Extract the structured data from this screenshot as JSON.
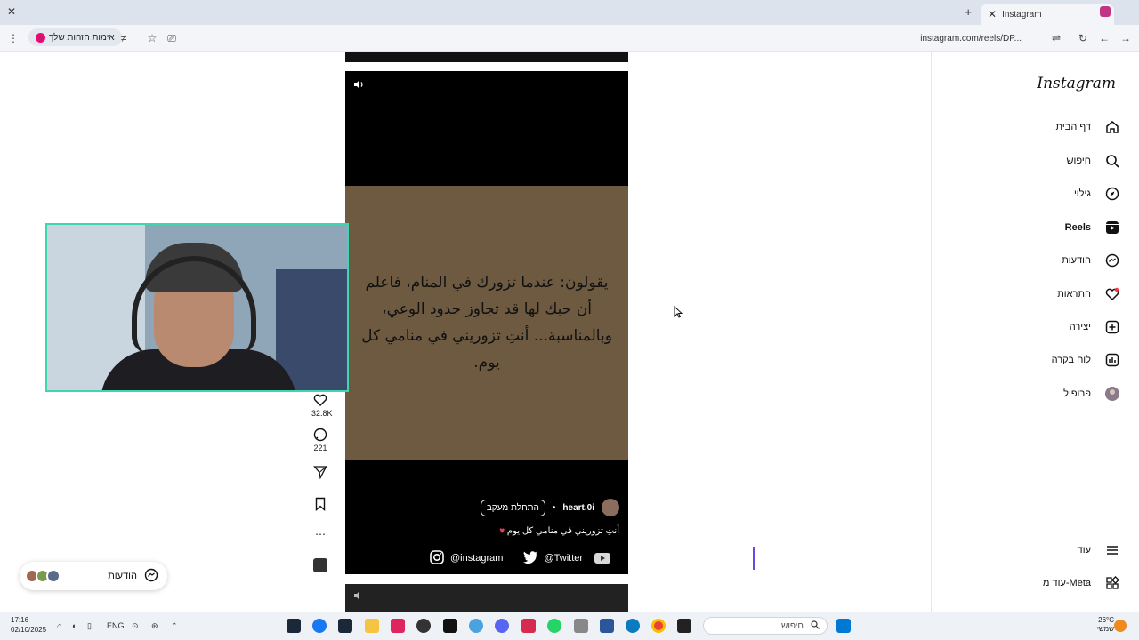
{
  "browser": {
    "tab_title": "Instagram",
    "url": "instagram.com/reels/DP...",
    "pill_label": "אימות הזהות שלך",
    "new_tab_symbol": "+",
    "close_symbol": "✕"
  },
  "sidebar": {
    "logo": "Instagram",
    "items": [
      {
        "label": "דף הבית",
        "icon": "home-icon"
      },
      {
        "label": "חיפוש",
        "icon": "search-icon"
      },
      {
        "label": "גילוי",
        "icon": "compass-icon"
      },
      {
        "label": "Reels",
        "icon": "reels-icon"
      },
      {
        "label": "הודעות",
        "icon": "messenger-icon"
      },
      {
        "label": "התראות",
        "icon": "heart-icon"
      },
      {
        "label": "יצירה",
        "icon": "plus-icon"
      },
      {
        "label": "לוח בקרה",
        "icon": "dashboard-icon"
      },
      {
        "label": "פרופיל",
        "icon": "avatar-icon"
      }
    ],
    "more": "עוד",
    "meta": "עוד מ-Meta"
  },
  "reel": {
    "quote": "يقولون: عندما تزورك في المنام، فاعلم أن حبك لها قد تجاوز حدود الوعي، وبالمناسبة... أنتِ تزوريني في منامي كل يوم.",
    "author": "heart.0i",
    "separator": "•",
    "follow_label": "התחלת מעקב",
    "caption": "أنتِ تزوريني في منامي كل يوم",
    "likes": "32.8K",
    "comments": "221"
  },
  "overlay": {
    "instagram_handle": "@instagram",
    "twitter_handle": "@Twitter"
  },
  "messages_widget": {
    "label": "הודעות"
  },
  "taskbar": {
    "time": "17:16",
    "date": "02/10/2025",
    "lang": "ENG",
    "search_placeholder": "חיפוש",
    "temp": "26°C",
    "weather": "שמשי"
  },
  "colors": {
    "accent": "#3dd6b0",
    "instagram_pink": "#e4405f",
    "card_brown": "#6d5a40"
  }
}
